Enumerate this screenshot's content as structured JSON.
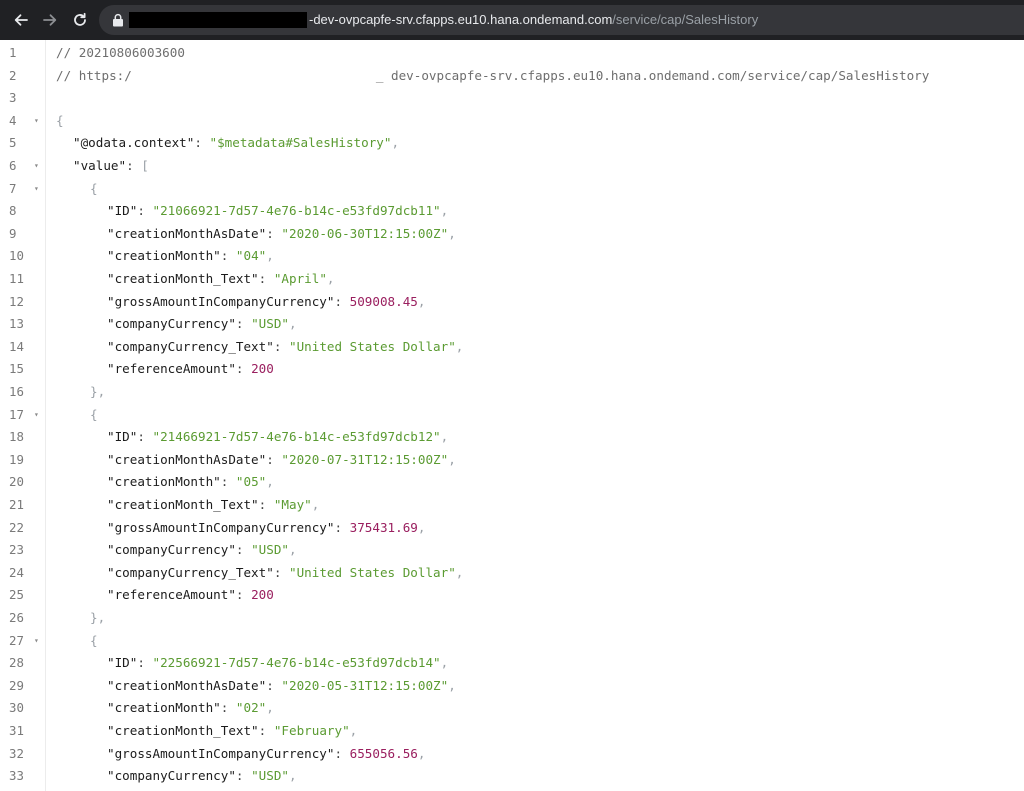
{
  "browser": {
    "url_host": "-dev-ovpcapfe-srv.cfapps.eu10.hana.ondemand.com",
    "url_path": "/service/cap/SalesHistory",
    "colors": {
      "toolbar_bg": "#202124",
      "omnibox_bg": "#35363a",
      "host_text": "#e8eaed",
      "path_text": "#9aa0a6"
    },
    "icons": [
      "back-arrow-icon",
      "forward-arrow-icon",
      "reload-icon",
      "lock-icon"
    ]
  },
  "viewer": {
    "colors": {
      "string": "#5b9b32",
      "number": "#9a1f5f",
      "key": "#1c1c1c",
      "comment": "#6e6e6e",
      "punct": "#9aa0a6"
    },
    "lines": [
      {
        "n": "1",
        "fold": "",
        "indent": 0,
        "tokens": [
          {
            "t": "// 20210806003600",
            "c": "comment"
          }
        ]
      },
      {
        "n": "2",
        "fold": "",
        "indent": 0,
        "tokens": [
          {
            "t": "// https:/",
            "c": "comment"
          },
          {
            "t": "",
            "c": "gap"
          },
          {
            "t": "_ dev-ovpcapfe-srv.cfapps.eu10.hana.ondemand.com/service/cap/SalesHistory",
            "c": "comment"
          }
        ]
      },
      {
        "n": "3",
        "fold": "",
        "indent": 0,
        "tokens": []
      },
      {
        "n": "4",
        "fold": "▾",
        "indent": 0,
        "tokens": [
          {
            "t": "{",
            "c": "punc"
          }
        ]
      },
      {
        "n": "5",
        "fold": "",
        "indent": 1,
        "tokens": [
          {
            "t": "\"@odata.context\"",
            "c": "key"
          },
          {
            "t": ": ",
            "c": "colon"
          },
          {
            "t": "\"$metadata#SalesHistory\"",
            "c": "str"
          },
          {
            "t": ",",
            "c": "punc"
          }
        ]
      },
      {
        "n": "6",
        "fold": "▾",
        "indent": 1,
        "tokens": [
          {
            "t": "\"value\"",
            "c": "key"
          },
          {
            "t": ": ",
            "c": "colon"
          },
          {
            "t": "[",
            "c": "punc"
          }
        ]
      },
      {
        "n": "7",
        "fold": "▾",
        "indent": 2,
        "tokens": [
          {
            "t": "{",
            "c": "punc"
          }
        ]
      },
      {
        "n": "8",
        "fold": "",
        "indent": 3,
        "tokens": [
          {
            "t": "\"ID\"",
            "c": "key"
          },
          {
            "t": ": ",
            "c": "colon"
          },
          {
            "t": "\"21066921-7d57-4e76-b14c-e53fd97dcb11\"",
            "c": "str"
          },
          {
            "t": ",",
            "c": "punc"
          }
        ]
      },
      {
        "n": "9",
        "fold": "",
        "indent": 3,
        "tokens": [
          {
            "t": "\"creationMonthAsDate\"",
            "c": "key"
          },
          {
            "t": ": ",
            "c": "colon"
          },
          {
            "t": "\"2020-06-30T12:15:00Z\"",
            "c": "str"
          },
          {
            "t": ",",
            "c": "punc"
          }
        ]
      },
      {
        "n": "10",
        "fold": "",
        "indent": 3,
        "tokens": [
          {
            "t": "\"creationMonth\"",
            "c": "key"
          },
          {
            "t": ": ",
            "c": "colon"
          },
          {
            "t": "\"04\"",
            "c": "str"
          },
          {
            "t": ",",
            "c": "punc"
          }
        ]
      },
      {
        "n": "11",
        "fold": "",
        "indent": 3,
        "tokens": [
          {
            "t": "\"creationMonth_Text\"",
            "c": "key"
          },
          {
            "t": ": ",
            "c": "colon"
          },
          {
            "t": "\"April\"",
            "c": "str"
          },
          {
            "t": ",",
            "c": "punc"
          }
        ]
      },
      {
        "n": "12",
        "fold": "",
        "indent": 3,
        "tokens": [
          {
            "t": "\"grossAmountInCompanyCurrency\"",
            "c": "key"
          },
          {
            "t": ": ",
            "c": "colon"
          },
          {
            "t": "509008.45",
            "c": "num"
          },
          {
            "t": ",",
            "c": "punc"
          }
        ]
      },
      {
        "n": "13",
        "fold": "",
        "indent": 3,
        "tokens": [
          {
            "t": "\"companyCurrency\"",
            "c": "key"
          },
          {
            "t": ": ",
            "c": "colon"
          },
          {
            "t": "\"USD\"",
            "c": "str"
          },
          {
            "t": ",",
            "c": "punc"
          }
        ]
      },
      {
        "n": "14",
        "fold": "",
        "indent": 3,
        "tokens": [
          {
            "t": "\"companyCurrency_Text\"",
            "c": "key"
          },
          {
            "t": ": ",
            "c": "colon"
          },
          {
            "t": "\"United States Dollar\"",
            "c": "str"
          },
          {
            "t": ",",
            "c": "punc"
          }
        ]
      },
      {
        "n": "15",
        "fold": "",
        "indent": 3,
        "tokens": [
          {
            "t": "\"referenceAmount\"",
            "c": "key"
          },
          {
            "t": ": ",
            "c": "colon"
          },
          {
            "t": "200",
            "c": "num"
          }
        ]
      },
      {
        "n": "16",
        "fold": "",
        "indent": 2,
        "tokens": [
          {
            "t": "},",
            "c": "punc"
          }
        ]
      },
      {
        "n": "17",
        "fold": "▾",
        "indent": 2,
        "tokens": [
          {
            "t": "{",
            "c": "punc"
          }
        ]
      },
      {
        "n": "18",
        "fold": "",
        "indent": 3,
        "tokens": [
          {
            "t": "\"ID\"",
            "c": "key"
          },
          {
            "t": ": ",
            "c": "colon"
          },
          {
            "t": "\"21466921-7d57-4e76-b14c-e53fd97dcb12\"",
            "c": "str"
          },
          {
            "t": ",",
            "c": "punc"
          }
        ]
      },
      {
        "n": "19",
        "fold": "",
        "indent": 3,
        "tokens": [
          {
            "t": "\"creationMonthAsDate\"",
            "c": "key"
          },
          {
            "t": ": ",
            "c": "colon"
          },
          {
            "t": "\"2020-07-31T12:15:00Z\"",
            "c": "str"
          },
          {
            "t": ",",
            "c": "punc"
          }
        ]
      },
      {
        "n": "20",
        "fold": "",
        "indent": 3,
        "tokens": [
          {
            "t": "\"creationMonth\"",
            "c": "key"
          },
          {
            "t": ": ",
            "c": "colon"
          },
          {
            "t": "\"05\"",
            "c": "str"
          },
          {
            "t": ",",
            "c": "punc"
          }
        ]
      },
      {
        "n": "21",
        "fold": "",
        "indent": 3,
        "tokens": [
          {
            "t": "\"creationMonth_Text\"",
            "c": "key"
          },
          {
            "t": ": ",
            "c": "colon"
          },
          {
            "t": "\"May\"",
            "c": "str"
          },
          {
            "t": ",",
            "c": "punc"
          }
        ]
      },
      {
        "n": "22",
        "fold": "",
        "indent": 3,
        "tokens": [
          {
            "t": "\"grossAmountInCompanyCurrency\"",
            "c": "key"
          },
          {
            "t": ": ",
            "c": "colon"
          },
          {
            "t": "375431.69",
            "c": "num"
          },
          {
            "t": ",",
            "c": "punc"
          }
        ]
      },
      {
        "n": "23",
        "fold": "",
        "indent": 3,
        "tokens": [
          {
            "t": "\"companyCurrency\"",
            "c": "key"
          },
          {
            "t": ": ",
            "c": "colon"
          },
          {
            "t": "\"USD\"",
            "c": "str"
          },
          {
            "t": ",",
            "c": "punc"
          }
        ]
      },
      {
        "n": "24",
        "fold": "",
        "indent": 3,
        "tokens": [
          {
            "t": "\"companyCurrency_Text\"",
            "c": "key"
          },
          {
            "t": ": ",
            "c": "colon"
          },
          {
            "t": "\"United States Dollar\"",
            "c": "str"
          },
          {
            "t": ",",
            "c": "punc"
          }
        ]
      },
      {
        "n": "25",
        "fold": "",
        "indent": 3,
        "tokens": [
          {
            "t": "\"referenceAmount\"",
            "c": "key"
          },
          {
            "t": ": ",
            "c": "colon"
          },
          {
            "t": "200",
            "c": "num"
          }
        ]
      },
      {
        "n": "26",
        "fold": "",
        "indent": 2,
        "tokens": [
          {
            "t": "},",
            "c": "punc"
          }
        ]
      },
      {
        "n": "27",
        "fold": "▾",
        "indent": 2,
        "tokens": [
          {
            "t": "{",
            "c": "punc"
          }
        ]
      },
      {
        "n": "28",
        "fold": "",
        "indent": 3,
        "tokens": [
          {
            "t": "\"ID\"",
            "c": "key"
          },
          {
            "t": ": ",
            "c": "colon"
          },
          {
            "t": "\"22566921-7d57-4e76-b14c-e53fd97dcb14\"",
            "c": "str"
          },
          {
            "t": ",",
            "c": "punc"
          }
        ]
      },
      {
        "n": "29",
        "fold": "",
        "indent": 3,
        "tokens": [
          {
            "t": "\"creationMonthAsDate\"",
            "c": "key"
          },
          {
            "t": ": ",
            "c": "colon"
          },
          {
            "t": "\"2020-05-31T12:15:00Z\"",
            "c": "str"
          },
          {
            "t": ",",
            "c": "punc"
          }
        ]
      },
      {
        "n": "30",
        "fold": "",
        "indent": 3,
        "tokens": [
          {
            "t": "\"creationMonth\"",
            "c": "key"
          },
          {
            "t": ": ",
            "c": "colon"
          },
          {
            "t": "\"02\"",
            "c": "str"
          },
          {
            "t": ",",
            "c": "punc"
          }
        ]
      },
      {
        "n": "31",
        "fold": "",
        "indent": 3,
        "tokens": [
          {
            "t": "\"creationMonth_Text\"",
            "c": "key"
          },
          {
            "t": ": ",
            "c": "colon"
          },
          {
            "t": "\"February\"",
            "c": "str"
          },
          {
            "t": ",",
            "c": "punc"
          }
        ]
      },
      {
        "n": "32",
        "fold": "",
        "indent": 3,
        "tokens": [
          {
            "t": "\"grossAmountInCompanyCurrency\"",
            "c": "key"
          },
          {
            "t": ": ",
            "c": "colon"
          },
          {
            "t": "655056.56",
            "c": "num"
          },
          {
            "t": ",",
            "c": "punc"
          }
        ]
      },
      {
        "n": "33",
        "fold": "",
        "indent": 3,
        "tokens": [
          {
            "t": "\"companyCurrency\"",
            "c": "key"
          },
          {
            "t": ": ",
            "c": "colon"
          },
          {
            "t": "\"USD\"",
            "c": "str"
          },
          {
            "t": ",",
            "c": "punc"
          }
        ]
      }
    ]
  }
}
